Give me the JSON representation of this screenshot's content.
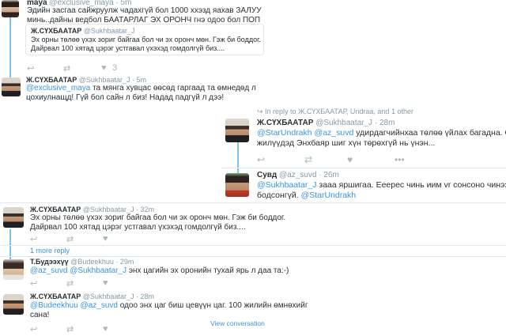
{
  "tweets": {
    "maya": {
      "name": "maya",
      "handle": "@exclusive_maya",
      "time": "· 5m",
      "line1": "Эдийн засгаа сайжруулж чадахгүй бол 1000 ххэзд яахав ЗАЛУУ",
      "line2": "минь..дайны ведбол БААТАРЛАГ ЭХ ОРОНЧ гнэ одоо бол ПОП",
      "quote_name": "Ж.СҮХБААТАР",
      "quote_handle": "@Sukhbaatar_J",
      "quote_line1": "Эх орны төлөө үхэх зориг байгаа бол чи эх оронч мөн. Гэж би боддог.",
      "quote_line2": "Дайрвал 100 хятад цэрэг устгавал үхэхэд гомдолгүй биз....",
      "like_count": "3"
    },
    "sukh1": {
      "name": "Ж.СҮХБААТАР",
      "handle": "@Sukhbaatar_J",
      "time": "· 5m",
      "mention": "@exclusive_maya",
      "line1_rest": " та мянга хувцас өөсөд гаргаад та өмнедөд л",
      "line2": "цохиулнащд! Гүй бол сайн л биз! Надад падгүй л дээ!"
    },
    "reply_context": "In reply to Ж.СҮХБААТАР, Undraa, and 1 other",
    "sukh2": {
      "name": "Ж.СҮХБААТАР",
      "handle": "@Sukhbaatar_J",
      "time": "· 28m",
      "mention1": "@StarUndrakh",
      "mention2": "@az_suvd",
      "line1_rest": " удирдагчийнхаа төлөө үйлах багадна. Ойры",
      "line2": "жилүүдэд Энхбаяр шиг хүн төрөхгүй нь үнэн..."
    },
    "suvd": {
      "name": "Сувд",
      "handle": "@az_suvd",
      "time": "· 26m",
      "mention1": "@Sukhbaatar_J",
      "line1_rest": " зааа яршигаа. Ееерес чинь иим vr сонсоно чинээ",
      "line2_prefix": "бодсонгүй. ",
      "mention2": "@StarUndrakh"
    },
    "sukh3": {
      "name": "Ж.СҮХБААТАР",
      "handle": "@Sukhbaatar_J",
      "time": "· 32m",
      "line1": "Эх орны төлөө үхэх зориг байгаа бол чи эх оронч мөн. Гэж би боддог.",
      "line2": "Дайрвал 100 хятад цэрэг устгавал үхэхэд гомдолгүй биз...."
    },
    "more_replies": "1 more reply",
    "budee": {
      "name": "Т.Будээхүү",
      "handle": "@Budeekhuu",
      "time": "· 29m",
      "mention1": "@az_suvd",
      "mention2": "@Sukhbaatar_J",
      "text_rest": " энх цагийн эх оронийн тухай ярь л даа та:-)"
    },
    "sukh4": {
      "name": "Ж.СҮХБААТАР",
      "handle": "@Sukhbaatar_J",
      "time": "· 28m",
      "mention1": "@Budeekhuu",
      "mention2": "@az_suvd",
      "line1_rest": " одоо энх цаг биш цевүүн цаг. 100 жилийн өмнөхийг",
      "line2": "сана!",
      "view_conversation": "View conversation"
    }
  },
  "colors": {
    "link": "#3b94d9",
    "thread_line": "#7ec0ea",
    "muted": "#8899a6"
  }
}
